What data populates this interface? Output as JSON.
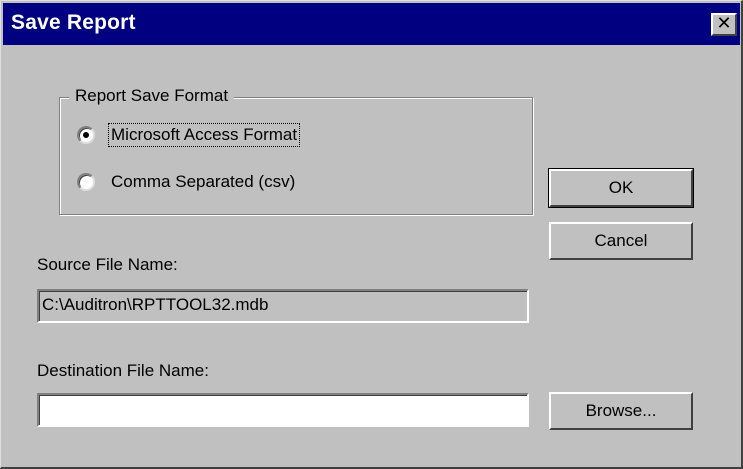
{
  "window": {
    "title": "Save Report",
    "close_glyph": "✕"
  },
  "format_group": {
    "legend": "Report Save Format",
    "options": [
      {
        "label": "Microsoft Access Format",
        "selected": true
      },
      {
        "label": "Comma Separated (csv)",
        "selected": false
      }
    ]
  },
  "buttons": {
    "ok": "OK",
    "cancel": "Cancel",
    "browse": "Browse..."
  },
  "source": {
    "label": "Source File Name:",
    "value": "C:\\Auditron\\RPTTOOL32.mdb"
  },
  "destination": {
    "label": "Destination File Name:",
    "value": ""
  },
  "colors": {
    "titlebar": "#000080",
    "face": "#c0c0c0"
  }
}
